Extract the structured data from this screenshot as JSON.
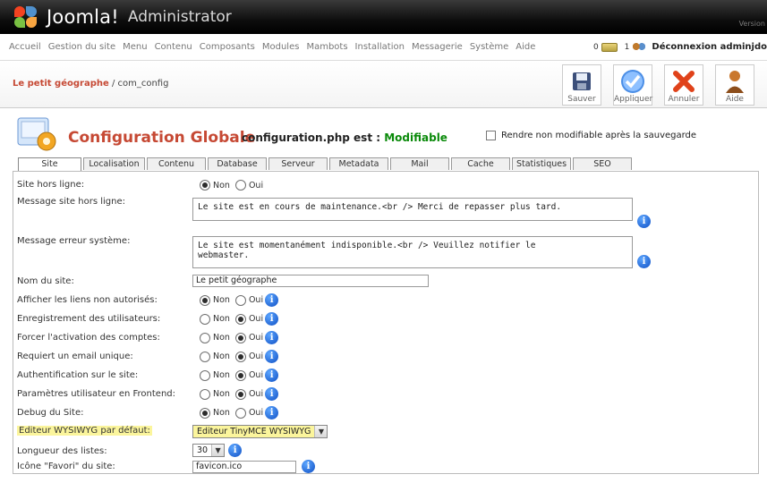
{
  "header": {
    "brand": "Joomla!",
    "subtitle": "Administrator",
    "version_label": "Version"
  },
  "menu": {
    "items": [
      "Accueil",
      "Gestion du site",
      "Menu",
      "Contenu",
      "Composants",
      "Modules",
      "Mambots",
      "Installation",
      "Messagerie",
      "Système",
      "Aide"
    ]
  },
  "status": {
    "messages_count": "0",
    "users_count": "1",
    "logout_label": "Déconnexion adminjdo"
  },
  "breadcrumb": {
    "site": "Le petit géographe",
    "path": " / com_config"
  },
  "toolbar": {
    "save": "Sauver",
    "apply": "Appliquer",
    "cancel": "Annuler",
    "help": "Aide"
  },
  "page": {
    "title": "Configuration Globale",
    "file_label": "configuration.php est : ",
    "file_state": "Modifiable",
    "lock_label": "Rendre non modifiable après la sauvegarde",
    "lock_checked": false
  },
  "tabs": [
    "Site",
    "Localisation",
    "Contenu",
    "Database",
    "Serveur",
    "Metadata",
    "Mail",
    "Cache",
    "Statistiques",
    "SEO"
  ],
  "active_tab": "Site",
  "form": {
    "offline": {
      "label": "Site hors ligne:",
      "opt_no": "Non",
      "opt_yes": "Oui",
      "value": "Non"
    },
    "offline_message": {
      "label": "Message site hors ligne:",
      "value": "Le site est en cours de maintenance.<br /> Merci de repasser plus tard."
    },
    "error_message": {
      "label": "Message erreur système:",
      "value_line1": "Le site est momentanément indisponible.<br /> Veuillez notifier le",
      "value_line2": "webmaster."
    },
    "site_name": {
      "label": "Nom du site:",
      "value": "Le petit géographe"
    },
    "unauthorized_links": {
      "label": "Afficher les liens non autorisés:",
      "opt_no": "Non",
      "opt_yes": "Oui",
      "value": "Non"
    },
    "user_registration": {
      "label": "Enregistrement des utilisateurs:",
      "opt_no": "Non",
      "opt_yes": "Oui",
      "value": "Oui"
    },
    "account_activation": {
      "label": "Forcer l'activation des comptes:",
      "opt_no": "Non",
      "opt_yes": "Oui",
      "value": "Oui"
    },
    "unique_email": {
      "label": "Requiert un email unique:",
      "opt_no": "Non",
      "opt_yes": "Oui",
      "value": "Oui"
    },
    "site_auth": {
      "label": "Authentification sur le site:",
      "opt_no": "Non",
      "opt_yes": "Oui",
      "value": "Oui"
    },
    "frontend_params": {
      "label": "Paramètres utilisateur en Frontend:",
      "opt_no": "Non",
      "opt_yes": "Oui",
      "value": "Oui"
    },
    "debug": {
      "label": "Debug du Site:",
      "opt_no": "Non",
      "opt_yes": "Oui",
      "value": "Non"
    },
    "editor": {
      "label": "Editeur WYSIWYG par défaut:",
      "value": "Editeur TinyMCE WYSIWYG"
    },
    "list_length": {
      "label": "Longueur des listes:",
      "value": "30"
    },
    "favicon": {
      "label": "Icône \"Favori\" du site:",
      "value": "favicon.ico"
    }
  },
  "colors": {
    "accent_title": "#c64934",
    "modifiable": "#0a8a0a",
    "highlight": "#fbf59c",
    "info_icon": "#1a63d6"
  }
}
